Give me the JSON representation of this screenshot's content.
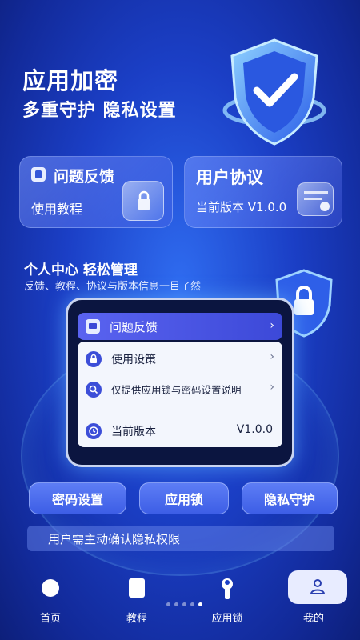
{
  "hero": {
    "title": "应用加密",
    "subtitle": "多重守护 隐私设置",
    "shield_icon": "shield-check-icon"
  },
  "cards": {
    "feedback": {
      "title": "问题反馈",
      "subtitle": "使用教程",
      "icon": "feedback-icon",
      "graphic": "lock-tile-icon"
    },
    "agreement": {
      "title": "用户协议",
      "version_text": "当前版本 V1.0.0",
      "graphic": "settings-tile-icon"
    }
  },
  "section": {
    "title": "个人中心 轻松管理",
    "subtitle": "反馈、教程、协议与版本信息一目了然",
    "icon": "lock-shield-icon"
  },
  "device": {
    "header_label": "问题反馈",
    "rows": [
      {
        "label": "使用设策",
        "icon": "lock-icon",
        "chevron": "›"
      },
      {
        "label": "仅提供应用锁与密码设置说明",
        "icon": "search-icon",
        "chevron": "›"
      },
      {
        "label": "当前版本",
        "icon": "clock-icon",
        "value": "V1.0.0"
      }
    ],
    "header_chevron": "›"
  },
  "actions": {
    "password": "密码设置",
    "applock": "应用锁",
    "privacy": "隐私守护"
  },
  "notice": "用户需主动确认隐私权限",
  "tabs": [
    {
      "label": "首页",
      "icon": "home-circle-icon"
    },
    {
      "label": "教程",
      "icon": "book-icon"
    },
    {
      "label": "应用锁",
      "icon": "wrench-icon"
    },
    {
      "label": "我的",
      "icon": "person-icon",
      "active": true
    }
  ],
  "colors": {
    "background": "#1b3fc6",
    "accent": "#3c4ed8",
    "active_tab_bg": "#e8ecff"
  }
}
